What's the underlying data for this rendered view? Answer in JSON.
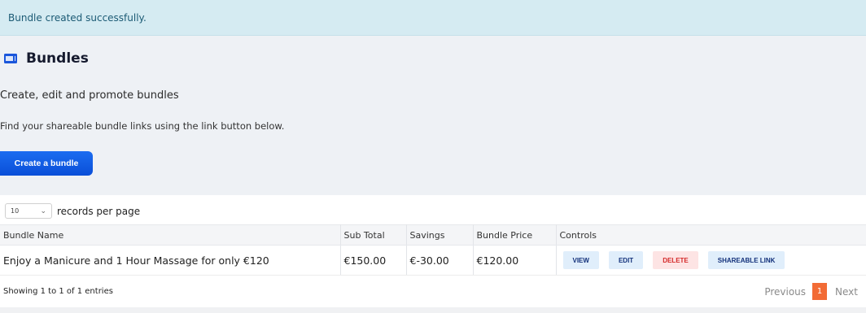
{
  "alert": {
    "message": "Bundle created successfully."
  },
  "header": {
    "title": "Bundles",
    "icon": "ticket-icon",
    "subtitle": "Create, edit and promote bundles",
    "hint": "Find your shareable bundle links using the link button below.",
    "create_button": "Create a bundle"
  },
  "length": {
    "value": "10",
    "label": "records per page"
  },
  "table": {
    "columns": [
      "Bundle Name",
      "Sub Total",
      "Savings",
      "Bundle Price",
      "Controls"
    ],
    "rows": [
      {
        "name": "Enjoy a Manicure and 1 Hour Massage for only €120",
        "sub_total": "€150.00",
        "savings": "€-30.00",
        "bundle_price": "€120.00",
        "controls": {
          "view": "VIEW",
          "edit": "EDIT",
          "delete": "DELETE",
          "share": "SHAREABLE LINK"
        }
      }
    ]
  },
  "footer": {
    "info": "Showing 1 to 1 of 1 entries",
    "previous": "Previous",
    "current_page": "1",
    "next": "Next"
  },
  "colors": {
    "accent": "#0a4fd8",
    "pager_active": "#f26b35",
    "alert_bg": "#d5ebf2",
    "hero_bg": "#eef1f5",
    "delete": "#d42828"
  }
}
